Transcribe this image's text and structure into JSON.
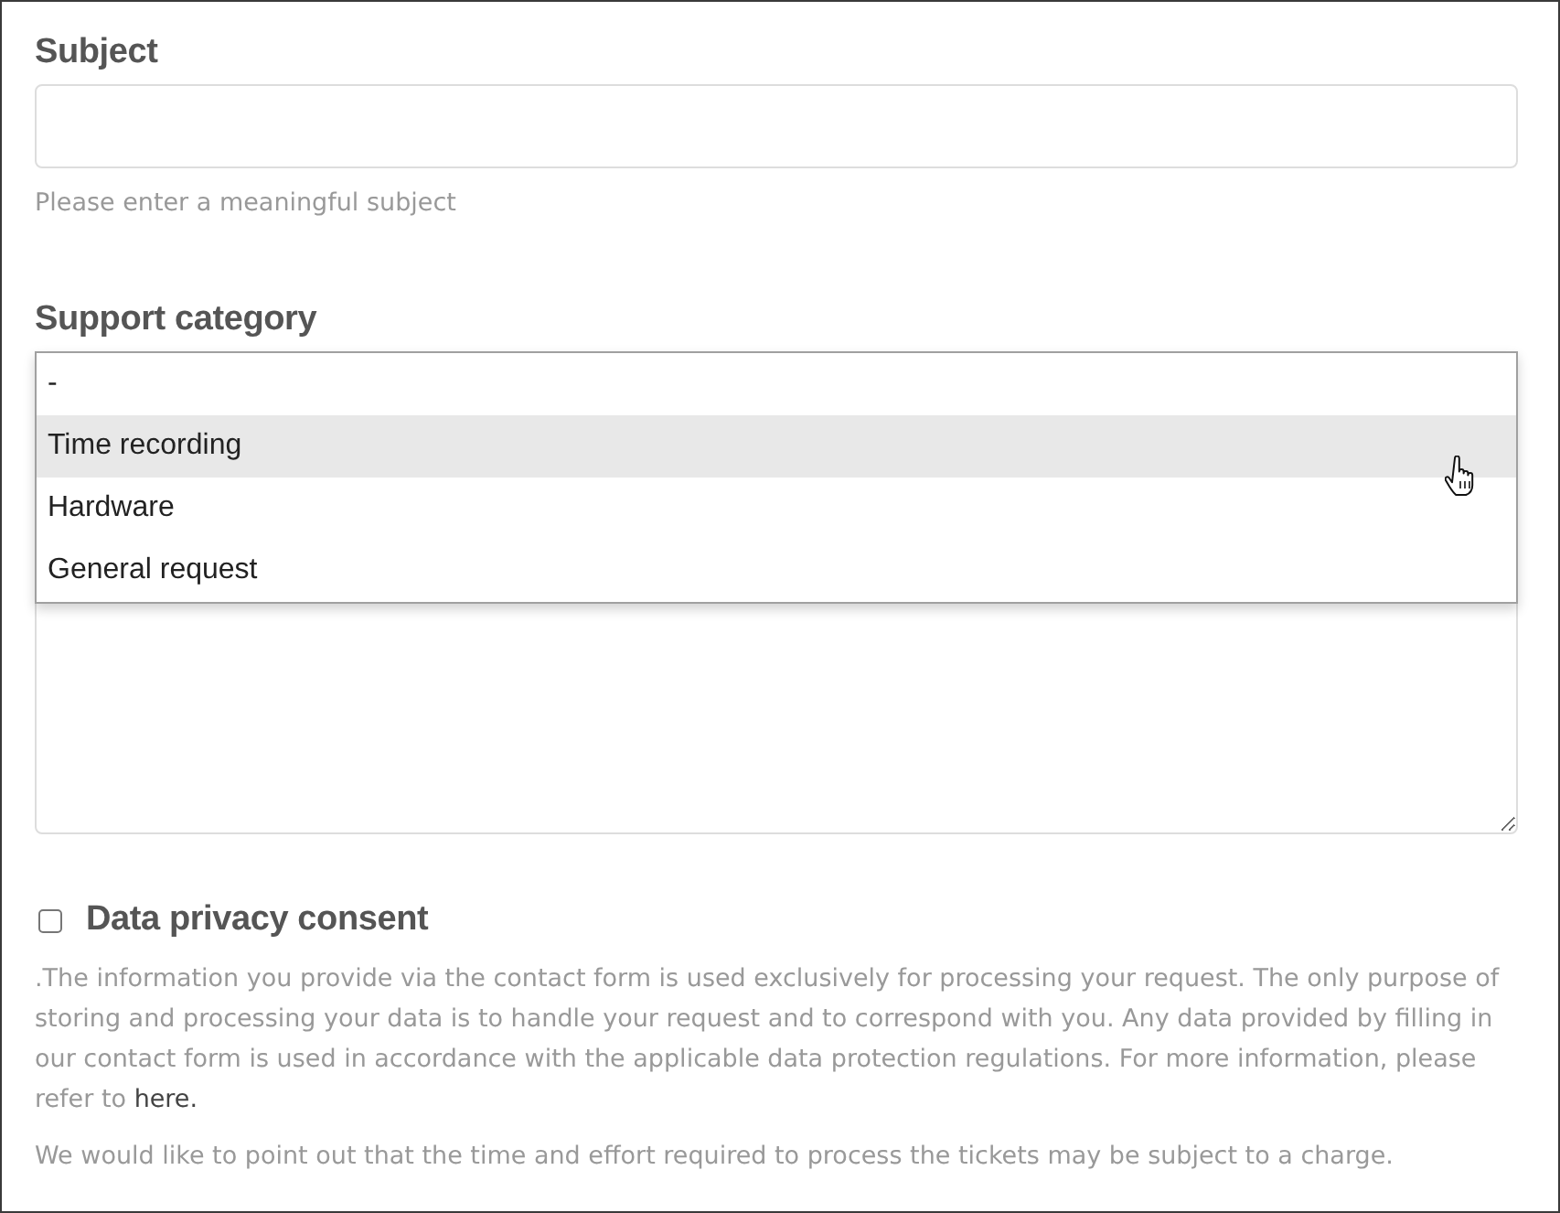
{
  "subject": {
    "label": "Subject",
    "hint": "Please enter a meaningful subject"
  },
  "support_category": {
    "label": "Support category",
    "expanded": true,
    "options": [
      {
        "label": "-",
        "selected": false
      },
      {
        "label": "Time recording",
        "selected": true
      },
      {
        "label": "Hardware",
        "selected": false
      },
      {
        "label": "General request",
        "selected": false
      }
    ]
  },
  "message": {
    "resizable": true
  },
  "consent": {
    "label": "Data privacy consent",
    "checked": false,
    "paragraphs": [
      {
        "text": ".The information you provide via the contact form is used exclusively for processing your request. The only purpose of storing and processing your data is to handle your request and to correspond with you. Any data provided by filling in our contact form is used in accordance with the applicable data protection regulations. For more information, please refer to",
        "link": "here."
      },
      {
        "text": "We would like to point out that the time and effort required to process the tickets may be subject to a charge."
      }
    ]
  }
}
